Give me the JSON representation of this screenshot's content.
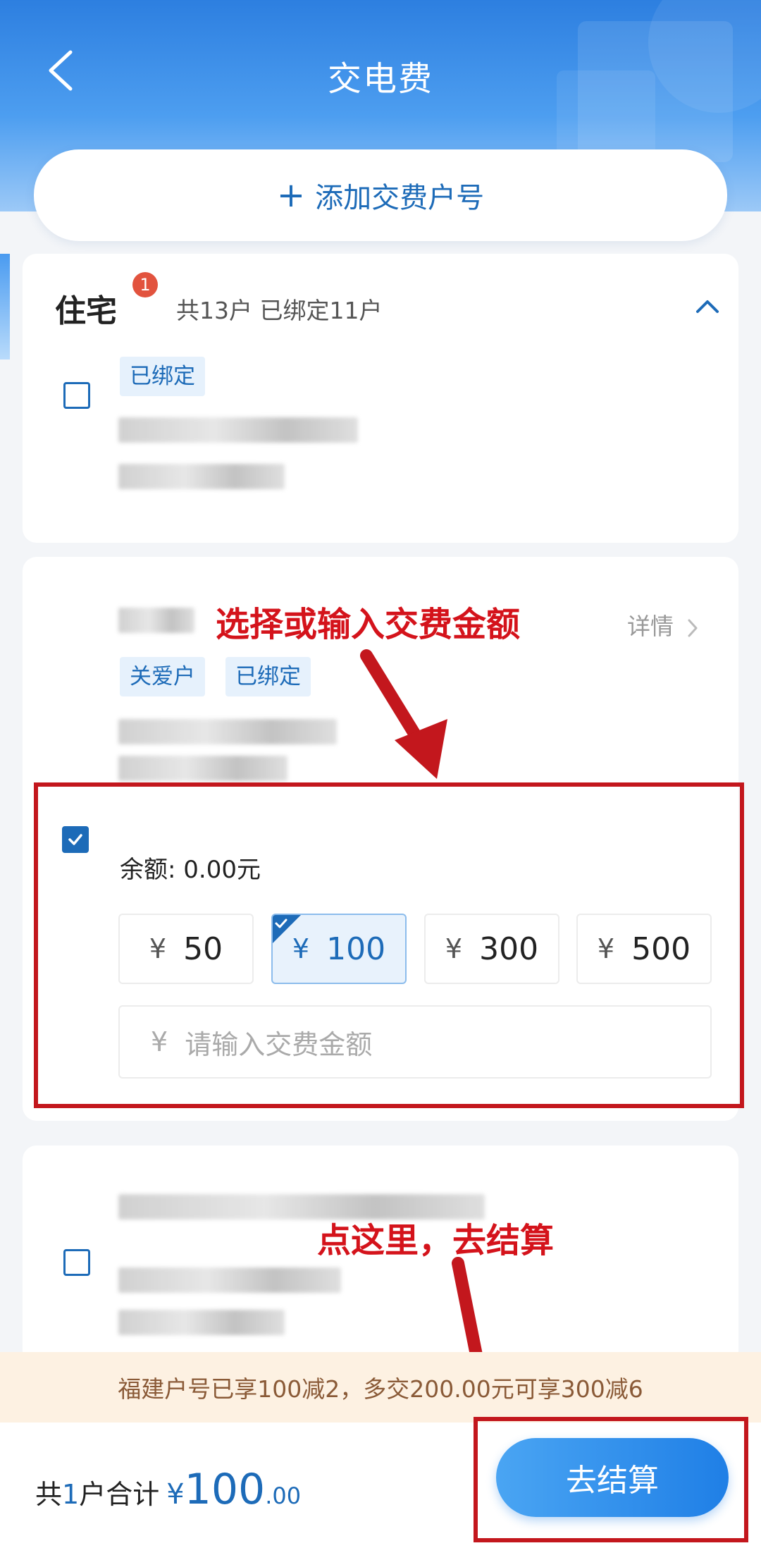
{
  "header": {
    "title": "交电费"
  },
  "add_account": {
    "label": "添加交费户号"
  },
  "section": {
    "title": "住宅",
    "badge": "1",
    "stats": "共13户 已绑定11户"
  },
  "cards": [
    {
      "tags": [
        "已绑定"
      ],
      "checked": false
    },
    {
      "tags": [
        "关爱户",
        "已绑定"
      ],
      "checked": true,
      "detail_label": "详情",
      "balance": "余额: 0.00元"
    },
    {
      "tags": [],
      "checked": false
    }
  ],
  "amounts": {
    "currency": "¥",
    "options": [
      {
        "value": "50",
        "selected": false
      },
      {
        "value": "100",
        "selected": true
      },
      {
        "value": "300",
        "selected": false
      },
      {
        "value": "500",
        "selected": false
      }
    ],
    "input_placeholder": "请输入交费金额"
  },
  "annotations": {
    "select_amount": "选择或输入交费金额",
    "checkout_hint": "点这里，去结算"
  },
  "promo": {
    "text": "福建户号已享100减2，多交200.00元可享300减6"
  },
  "footer": {
    "total_prefix": "共",
    "count": "1",
    "total_mid": "户合计",
    "currency": "¥",
    "amount_int": "100",
    "amount_dec": ".00",
    "checkout_label": "去结算"
  },
  "colors": {
    "primary": "#1d6bb8",
    "annotation": "#d4131b",
    "badge": "#e2533e"
  }
}
